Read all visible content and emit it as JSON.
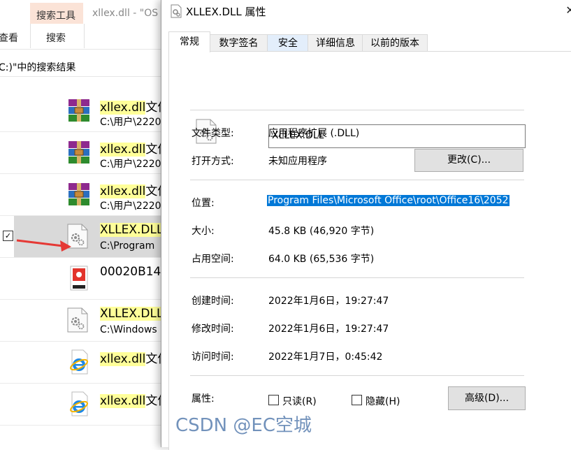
{
  "explorer": {
    "context_tab_group": "搜索工具",
    "title_fragment": "xllex.dll - \"OS",
    "ribbon_tab_view": "查看",
    "ribbon_tab_search": "搜索",
    "address_text": "C:)\"中的搜索结果",
    "results": [
      {
        "name_highlight": "xllex.dll",
        "name_rest": "文件",
        "path": "C:\\用户\\2220",
        "icon": "winrar-archive-icon"
      },
      {
        "name_highlight": "xllex.dll",
        "name_rest": "文件",
        "path": "C:\\用户\\2220",
        "icon": "winrar-archive-icon"
      },
      {
        "name_highlight": "xllex.dll",
        "name_rest": "文件",
        "path": "C:\\用户\\2220",
        "icon": "winrar-archive-icon"
      },
      {
        "name_highlight": "XLLEX.DLL",
        "name_rest": "",
        "path": "C:\\Program",
        "icon": "dll-gear-icon",
        "selected": true
      },
      {
        "name_highlight": "",
        "name_rest": "00020B14",
        "path": "",
        "icon": "red-document-icon"
      },
      {
        "name_highlight": "XLLEX.DLL",
        "name_rest": "",
        "path": "C:\\Windows",
        "icon": "dll-gear-icon"
      },
      {
        "name_highlight": "xllex.dll",
        "name_rest": "文件",
        "path": "",
        "icon": "internet-explorer-icon"
      },
      {
        "name_highlight": "xllex.dll",
        "name_rest": "文件",
        "path": "",
        "icon": "internet-explorer-icon"
      }
    ]
  },
  "dialog": {
    "title": "XLLEX.DLL 属性",
    "close_symbol": "✕",
    "tabs": [
      "常规",
      "数字签名",
      "安全",
      "详细信息",
      "以前的版本"
    ],
    "active_tab": "常规",
    "file_name": "XLLEX.DLL",
    "file_type_label": "文件类型:",
    "file_type_value": "应用程序扩展 (.DLL)",
    "open_with_label": "打开方式:",
    "open_with_value": "未知应用程序",
    "change_button": "更改(C)...",
    "location_label": "位置:",
    "location_value": "Program Files\\Microsoft Office\\root\\Office16\\2052",
    "size_label": "大小:",
    "size_value": "45.8 KB (46,920 字节)",
    "size_on_disk_label": "占用空间:",
    "size_on_disk_value": "64.0 KB (65,536 字节)",
    "created_label": "创建时间:",
    "created_value": "2022年1月6日，19:27:47",
    "modified_label": "修改时间:",
    "modified_value": "2022年1月6日，19:27:47",
    "accessed_label": "访问时间:",
    "accessed_value": "2022年1月7日，0:45:42",
    "attributes_label": "属性:",
    "readonly_label": "只读(R)",
    "hidden_label": "隐藏(H)",
    "advanced_button": "高级(D)..."
  },
  "watermark": "CSDN @EC空城",
  "colors": {
    "selection_blue": "#0078d7",
    "search_highlight": "#ffff99",
    "context_tab": "#fbe3d7",
    "arrow_red": "#e53935"
  }
}
